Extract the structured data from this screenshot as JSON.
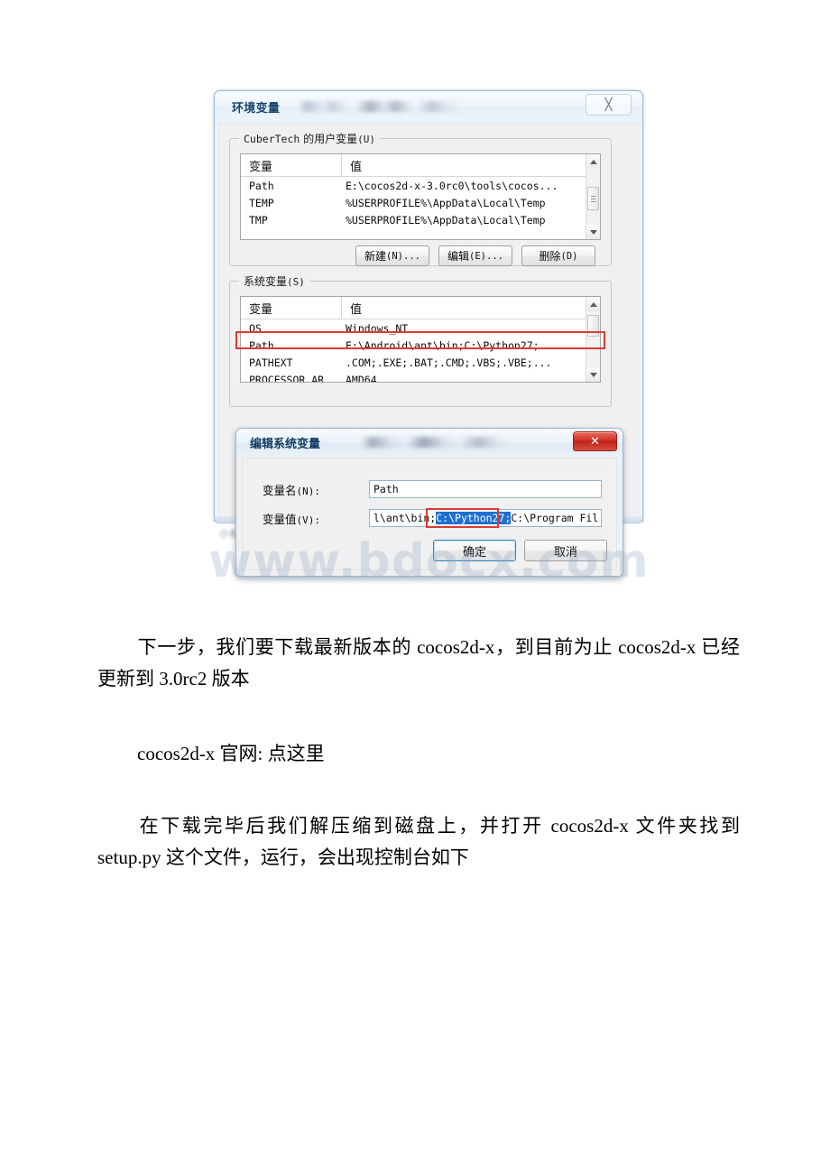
{
  "screenshot": {
    "outer_dialog": {
      "title": "环境变量",
      "close_label": "✕",
      "user_group": {
        "label_prefix": "CuberTech",
        "label_rest": " 的用户变量",
        "label_key": "(U)",
        "columns": [
          "变量",
          "值"
        ],
        "rows": [
          {
            "name": "Path",
            "value": "E:\\cocos2d-x-3.0rc0\\tools\\cocos..."
          },
          {
            "name": "TEMP",
            "value": "%USERPROFILE%\\AppData\\Local\\Temp"
          },
          {
            "name": "TMP",
            "value": "%USERPROFILE%\\AppData\\Local\\Temp"
          }
        ]
      },
      "user_buttons": [
        {
          "label": "新建",
          "key": "(N)...",
          "name": "new-button"
        },
        {
          "label": "编辑",
          "key": "(E)...",
          "name": "edit-button"
        },
        {
          "label": "删除",
          "key": "(D)",
          "name": "delete-button"
        }
      ],
      "system_group": {
        "label": "系统变量",
        "label_key": "(S)",
        "columns": [
          "变量",
          "值"
        ],
        "rows": [
          {
            "name": "OS",
            "value": "Windows_NT"
          },
          {
            "name": "Path",
            "value": "E:\\Android\\ant\\bin;C:\\Python27;...",
            "highlighted": true
          },
          {
            "name": "PATHEXT",
            "value": ".COM;.EXE;.BAT;.CMD;.VBS;.VBE;..."
          },
          {
            "name": "PROCESSOR_AR",
            "value": "AMD64"
          }
        ]
      }
    },
    "edit_dialog": {
      "title": "编辑系统变量",
      "close_label": "✕",
      "name_label": "变量名",
      "name_key": "(N):",
      "name_value": "Path",
      "value_label": "变量值",
      "value_key": "(V):",
      "value_before": "l\\ant\\bin;",
      "value_selected": "C:\\Python27;",
      "value_after": "C:\\Program Fil",
      "ok_label": "确定",
      "cancel_label": "取消"
    },
    "watermark": "www.bdocx.com",
    "accent_red": "#e03a32",
    "selection_blue": "#1f6fd0"
  },
  "article": {
    "p1": "下一步，我们要下载最新版本的 cocos2d-x，到目前为止 cocos2d-x 已经更新到 3.0rc2 版本",
    "p2": "cocos2d-x 官网: 点这里",
    "p3": "在下载完毕后我们解压缩到磁盘上，并打开 cocos2d-x 文件夹找到 setup.py 这个文件，运行，会出现控制台如下"
  }
}
